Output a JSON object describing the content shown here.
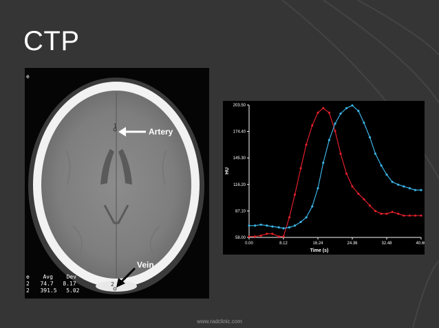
{
  "slide": {
    "title": "CTP",
    "footer": "www.radclinic.com"
  },
  "ct_image": {
    "artery_label": "Artery",
    "vein_label": "Vein",
    "marker_1": "1",
    "marker_2": "2",
    "corner_left_top": "e",
    "overlay_header": [
      "e",
      "Avg",
      "Dev"
    ],
    "overlay_rows": [
      [
        "2",
        "74.7",
        "8.17"
      ],
      [
        "2",
        "391.5",
        "5.02"
      ]
    ]
  },
  "chart_data": {
    "type": "line",
    "title": "",
    "xlabel": "Time (s)",
    "ylabel": "HU",
    "xlim": [
      0,
      40.6
    ],
    "ylim": [
      58.0,
      203.5
    ],
    "x_ticks": [
      "0.00",
      "8.12",
      "16.24",
      "24.36",
      "32.48",
      "40.60"
    ],
    "y_ticks": [
      "58.00",
      "87.10",
      "116.20",
      "145.30",
      "174.40",
      "203.50"
    ],
    "grid": false,
    "colors": {
      "series_red": "#e0202a",
      "series_blue": "#3cb4e6"
    },
    "series": [
      {
        "color": "#e0202a",
        "points": [
          [
            0.0,
            59
          ],
          [
            1.4,
            59
          ],
          [
            2.8,
            60
          ],
          [
            4.2,
            62
          ],
          [
            5.5,
            62
          ],
          [
            7.0,
            59
          ],
          [
            8.12,
            59
          ],
          [
            9.5,
            80
          ],
          [
            10.8,
            105
          ],
          [
            12.2,
            134
          ],
          [
            13.5,
            160
          ],
          [
            14.9,
            181
          ],
          [
            16.24,
            195
          ],
          [
            17.5,
            200
          ],
          [
            18.9,
            195
          ],
          [
            20.3,
            175
          ],
          [
            21.6,
            150
          ],
          [
            23.0,
            128
          ],
          [
            24.36,
            114
          ],
          [
            25.8,
            106
          ],
          [
            27.1,
            100
          ],
          [
            28.5,
            93
          ],
          [
            29.8,
            87
          ],
          [
            31.2,
            84
          ],
          [
            32.48,
            84
          ],
          [
            33.8,
            86
          ],
          [
            35.2,
            84
          ],
          [
            36.5,
            82
          ],
          [
            37.9,
            82
          ],
          [
            39.2,
            82
          ],
          [
            40.6,
            82
          ]
        ]
      },
      {
        "color": "#3cb4e6",
        "points": [
          [
            0.0,
            71
          ],
          [
            1.4,
            71
          ],
          [
            2.8,
            72
          ],
          [
            4.2,
            71
          ],
          [
            5.5,
            70
          ],
          [
            7.0,
            69
          ],
          [
            8.12,
            68
          ],
          [
            9.5,
            69
          ],
          [
            10.8,
            71
          ],
          [
            12.2,
            75
          ],
          [
            13.5,
            80
          ],
          [
            14.9,
            92
          ],
          [
            16.24,
            112
          ],
          [
            17.5,
            140
          ],
          [
            18.9,
            165
          ],
          [
            20.3,
            183
          ],
          [
            21.6,
            194
          ],
          [
            23.0,
            200
          ],
          [
            24.36,
            203
          ],
          [
            25.8,
            197
          ],
          [
            27.1,
            184
          ],
          [
            28.5,
            168
          ],
          [
            29.8,
            150
          ],
          [
            31.2,
            137
          ],
          [
            32.48,
            127
          ],
          [
            33.8,
            119
          ],
          [
            35.2,
            116
          ],
          [
            36.5,
            114
          ],
          [
            37.9,
            112
          ],
          [
            39.2,
            110
          ],
          [
            40.6,
            110
          ]
        ]
      }
    ]
  }
}
